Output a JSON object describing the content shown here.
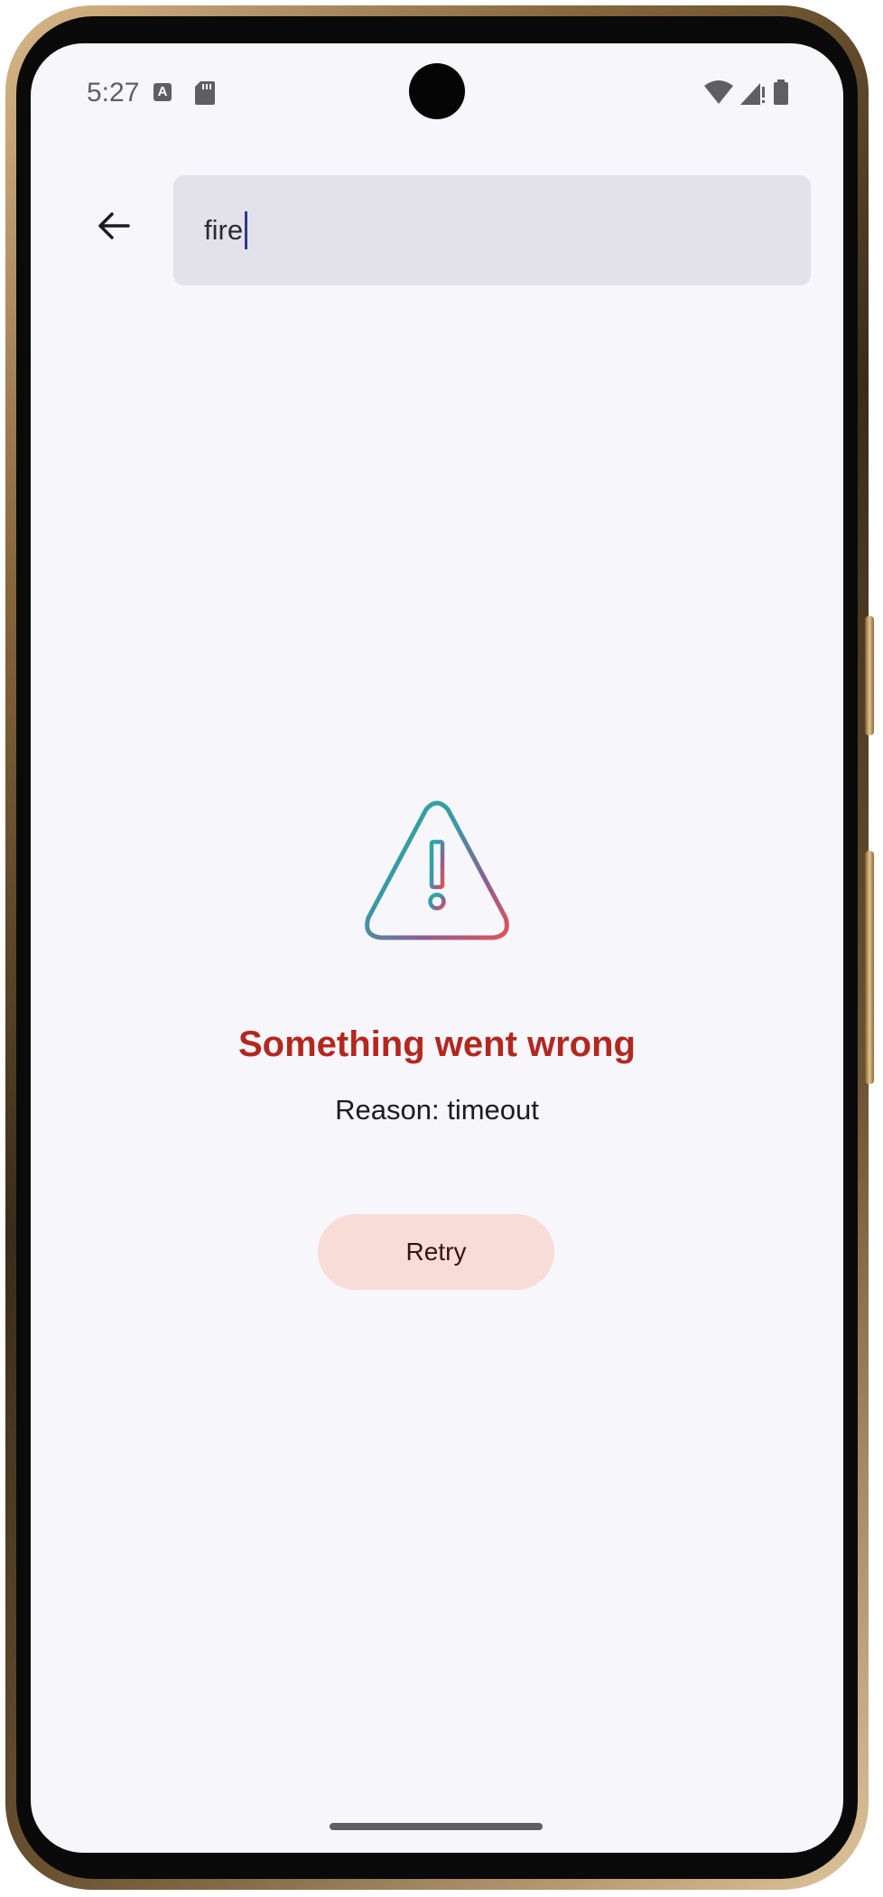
{
  "status_bar": {
    "time": "5:27",
    "notification_icons": [
      "font-a-icon",
      "sd-card-icon"
    ],
    "system_icons": [
      "wifi-icon",
      "signal-no-data-icon",
      "battery-icon"
    ]
  },
  "search": {
    "query": "fire",
    "back_icon": "arrow-back-icon"
  },
  "error": {
    "icon": "warning-triangle-icon",
    "title": "Something went wrong",
    "reason": "Reason: timeout",
    "retry_label": "Retry"
  },
  "colors": {
    "background": "#f7f6fb",
    "search_field": "#e3e2ea",
    "error_title": "#b3271f",
    "retry_button_bg": "#f8dcd8",
    "retry_button_text": "#3b1211",
    "icon_gradient_start": "#2aa89a",
    "icon_gradient_end": "#e0525a"
  }
}
